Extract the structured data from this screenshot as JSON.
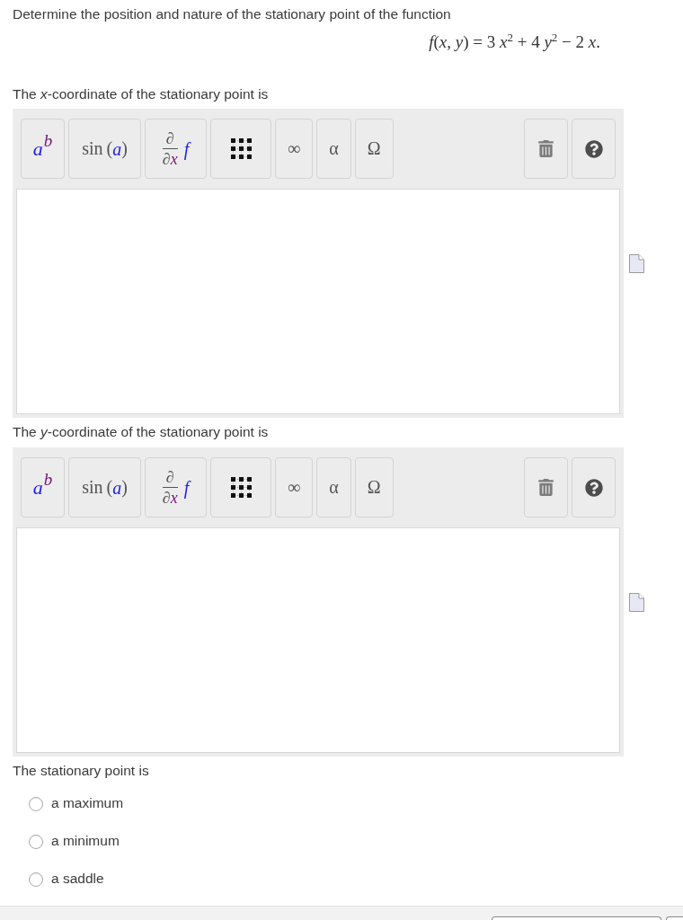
{
  "question": {
    "prompt": "Determine the position and nature of the stationary point of the function",
    "formula": "*f*(*x*, *y*) = 3 *x*$^{2}$ + 4 *y*$^{2}$ − 2 *x*."
  },
  "answers": [
    {
      "label": "The *x*-coordinate of the stationary point is",
      "toolbar": [
        {
          "kind": "power",
          "base": "a",
          "exponent": "b"
        },
        {
          "kind": "function",
          "name": "sin",
          "left": "(",
          "argument": "a",
          "right": ")"
        },
        {
          "kind": "derivative",
          "numerator": "∂",
          "denominator": "∂",
          "variable": "x",
          "operand": "f"
        },
        {
          "kind": "matrix"
        },
        {
          "kind": "symbol",
          "symbol": "∞"
        },
        {
          "kind": "symbol",
          "symbol": "α"
        },
        {
          "kind": "symbol",
          "symbol": "Ω"
        },
        {
          "kind": "delete"
        },
        {
          "kind": "help"
        }
      ]
    },
    {
      "label": "The *y*-coordinate of the stationary point is",
      "toolbar": [
        {
          "kind": "power",
          "base": "a",
          "exponent": "b"
        },
        {
          "kind": "function",
          "name": "sin",
          "left": "(",
          "argument": "a",
          "right": ")"
        },
        {
          "kind": "derivative",
          "numerator": "∂",
          "denominator": "∂",
          "variable": "x",
          "operand": "f"
        },
        {
          "kind": "matrix"
        },
        {
          "kind": "symbol",
          "symbol": "∞"
        },
        {
          "kind": "symbol",
          "symbol": "α"
        },
        {
          "kind": "symbol",
          "symbol": "Ω"
        },
        {
          "kind": "delete"
        },
        {
          "kind": "help"
        }
      ]
    }
  ],
  "nature": {
    "label": "The stationary point is",
    "choices": [
      {
        "label": "a maximum",
        "selected": false
      },
      {
        "label": "a minimum",
        "selected": false
      },
      {
        "label": "a saddle",
        "selected": false
      }
    ]
  }
}
